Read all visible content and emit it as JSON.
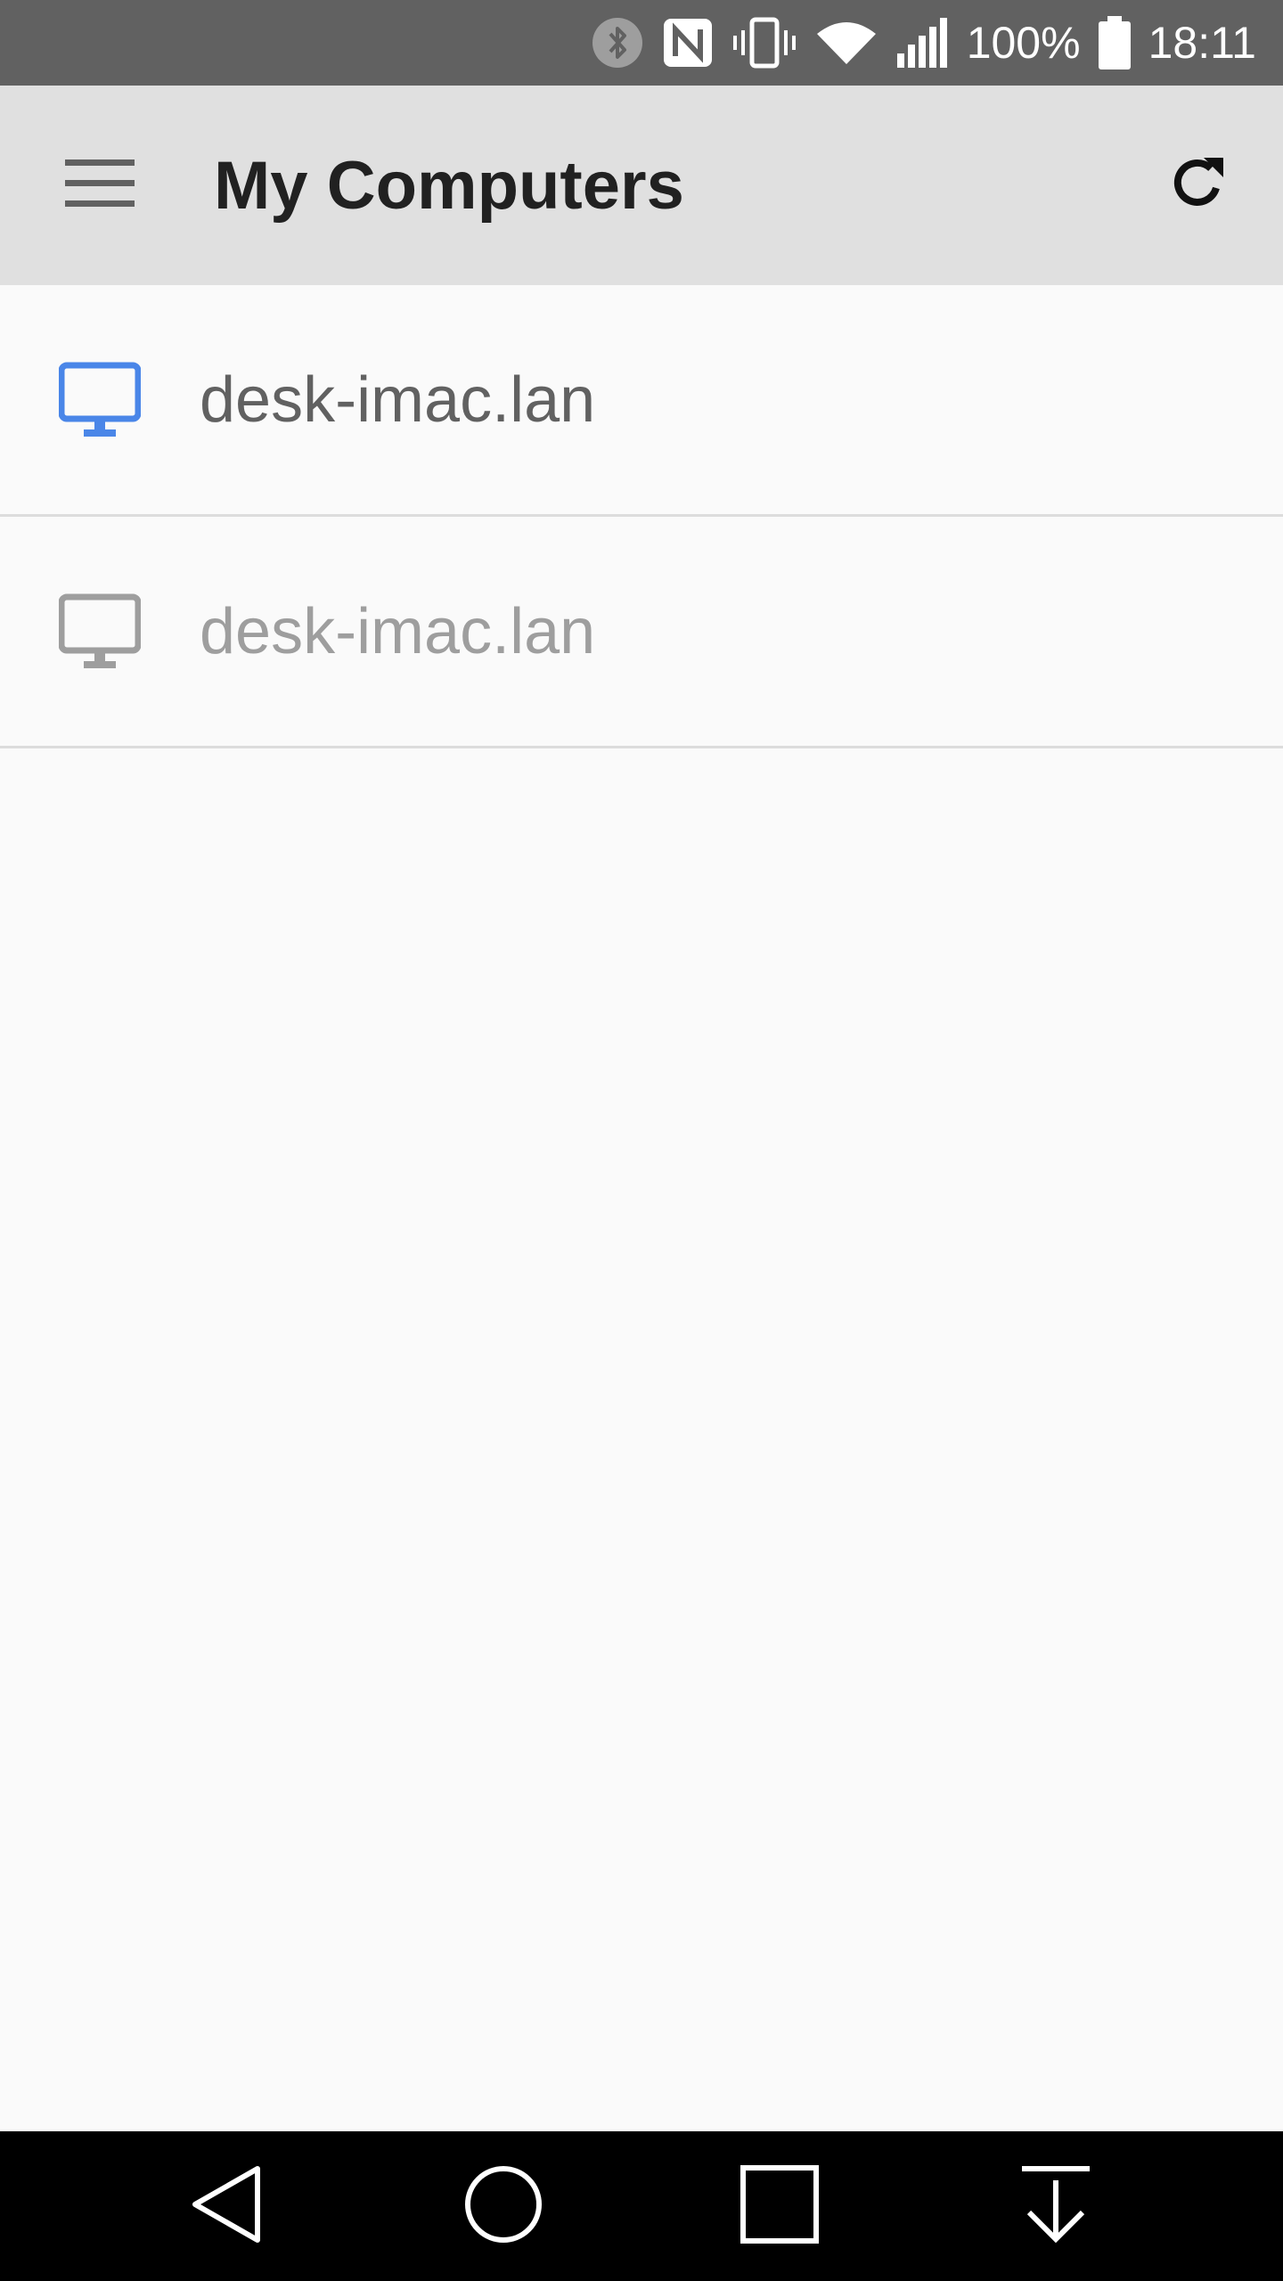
{
  "status_bar": {
    "battery_text": "100%",
    "time": "18:11",
    "icons": [
      "bluetooth-icon",
      "nfc-icon",
      "vibrate-icon",
      "wifi-icon",
      "signal-icon",
      "battery-icon"
    ]
  },
  "app_bar": {
    "title": "My Computers",
    "menu_icon": "hamburger-menu-icon",
    "refresh_icon": "refresh-icon"
  },
  "computers": [
    {
      "name": "desk-imac.lan",
      "status": "online",
      "icon": "desktop-monitor-icon",
      "icon_color": "#4a86e8"
    },
    {
      "name": "desk-imac.lan",
      "status": "offline",
      "icon": "desktop-monitor-icon",
      "icon_color": "#9e9e9e"
    }
  ],
  "nav_bar": {
    "buttons": [
      "back-icon",
      "home-icon",
      "recents-icon",
      "notification-down-icon"
    ]
  },
  "colors": {
    "status_bar": "#616161",
    "app_bar": "#e0e0e0",
    "background": "#fafafa",
    "accent": "#4a86e8"
  }
}
